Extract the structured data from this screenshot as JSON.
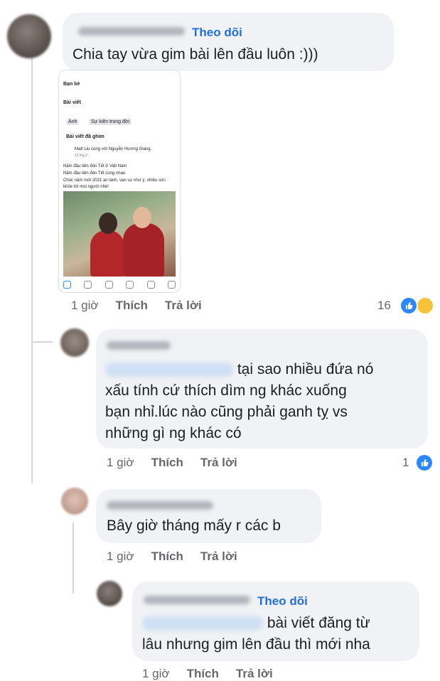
{
  "follow_label": "Theo dõi",
  "comments": [
    {
      "text": "Chia tay    vừa gim bài lên đầu luôn :)))",
      "time": "1 giờ",
      "like": "Thích",
      "reply": "Trả lời",
      "reaction_count": "16"
    },
    {
      "text_line1": "tại sao nhiều đứa nó",
      "text_lines": [
        "xấu tính  cứ thích dìm ng khác xuống",
        "bạn nhỉ.lúc nào cũng phải ganh tỵ vs",
        "những gì ng khác có"
      ],
      "time": "1 giờ",
      "like": "Thích",
      "reply": "Trả lời",
      "reaction_count": "1"
    },
    {
      "text": "Bây giờ tháng mấy r các b",
      "time": "1 giờ",
      "like": "Thích",
      "reply": "Trả lời"
    },
    {
      "text_line1": "bài viết đăng từ",
      "text_line2": "lâu nhưng gim lên đầu thì mới nha",
      "time": "1 giờ",
      "like": "Thích",
      "reply": "Trả lời"
    }
  ],
  "screenshot": {
    "friends": "Bạn bè",
    "posts": "Bài viết",
    "photo_btn": "Ảnh",
    "event_btn": "Sự kiện trong đời",
    "pinned": "Bài viết đã ghim",
    "author": "Matt Liu cùng với Nguyễn Hương Giang.",
    "date": "12 thg 2 ·",
    "line1": "Năm đầu tiên đón Tết ở Việt Nam",
    "line2": "Năm đầu tiên đón Tết cùng nhau",
    "line3": "Chúc năm mới 2021 an lành, vạn sự như ý, nhiều sức",
    "line4": "khỏe tới mọi người nhé!"
  },
  "colors": {
    "accent": "#216fdb",
    "bubble": "#f0f2f5",
    "meta": "#65676b",
    "like": "#2d88ff"
  }
}
